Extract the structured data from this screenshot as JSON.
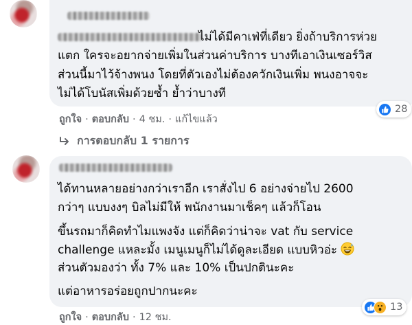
{
  "comment1": {
    "lines": [
      "ไม่ได้มีคาเฟ่ที่เดียว ยิ่งถ้าบริการห่วย",
      "แตก ใครจะอยากจ่ายเพิ่มในส่วนค่าบริการ บางทีเอาเงินเซอร์วิส",
      "ส่วนนี้มาไว้จ้างพนง โดยที่ตัวเองไม่ต้องควักเงินเพิ่ม พนงอาจจะ",
      "ไม่ได้โบนัสเพิ่มด้วยซ้ำ ย้ำว่าบางที"
    ],
    "actions": {
      "like": "ถูกใจ",
      "reply": "ตอบกลับ",
      "time": "4 ชม.",
      "edited": "แก้ไขแล้ว"
    },
    "reactions": {
      "count": "28",
      "icons": [
        "like-icon"
      ]
    },
    "view_replies": "การตอบกลับ 1 รายการ"
  },
  "comment2": {
    "lines": [
      "ได้ทานหลายอย่างกว่าเราอีก เราสั่งไป 6 อย่างจ่ายไป 2600",
      "กว่าๆ แบบงงๆ บิลไม่มีให้ พนักงานมาเช็คๆ แล้วก็โอน",
      "ขึ้นรถมาก็คิดทำไมแพงจัง แต่ก็คิดว่าน่าจะ vat กับ service",
      "challenge แหละมั้ง เมนูเมนูก็ไม่ได้ดูละเอียด แบบหิวอ่ะ",
      "ส่วนตัวมองว่า ทั้ง 7% และ 10% เป็นปกตินะคะ",
      "แต่อาหารอร่อยถูกปากนะคะ"
    ],
    "actions": {
      "like": "ถูกใจ",
      "reply": "ตอบกลับ",
      "time": "12 ชม."
    },
    "reactions": {
      "count": "13",
      "icons": [
        "like-icon",
        "wow-icon"
      ]
    }
  },
  "colors": {
    "bubble": "#f0f2f5",
    "like_blue": "#1877f2",
    "meta_gray": "#65676b",
    "text": "#050505"
  }
}
